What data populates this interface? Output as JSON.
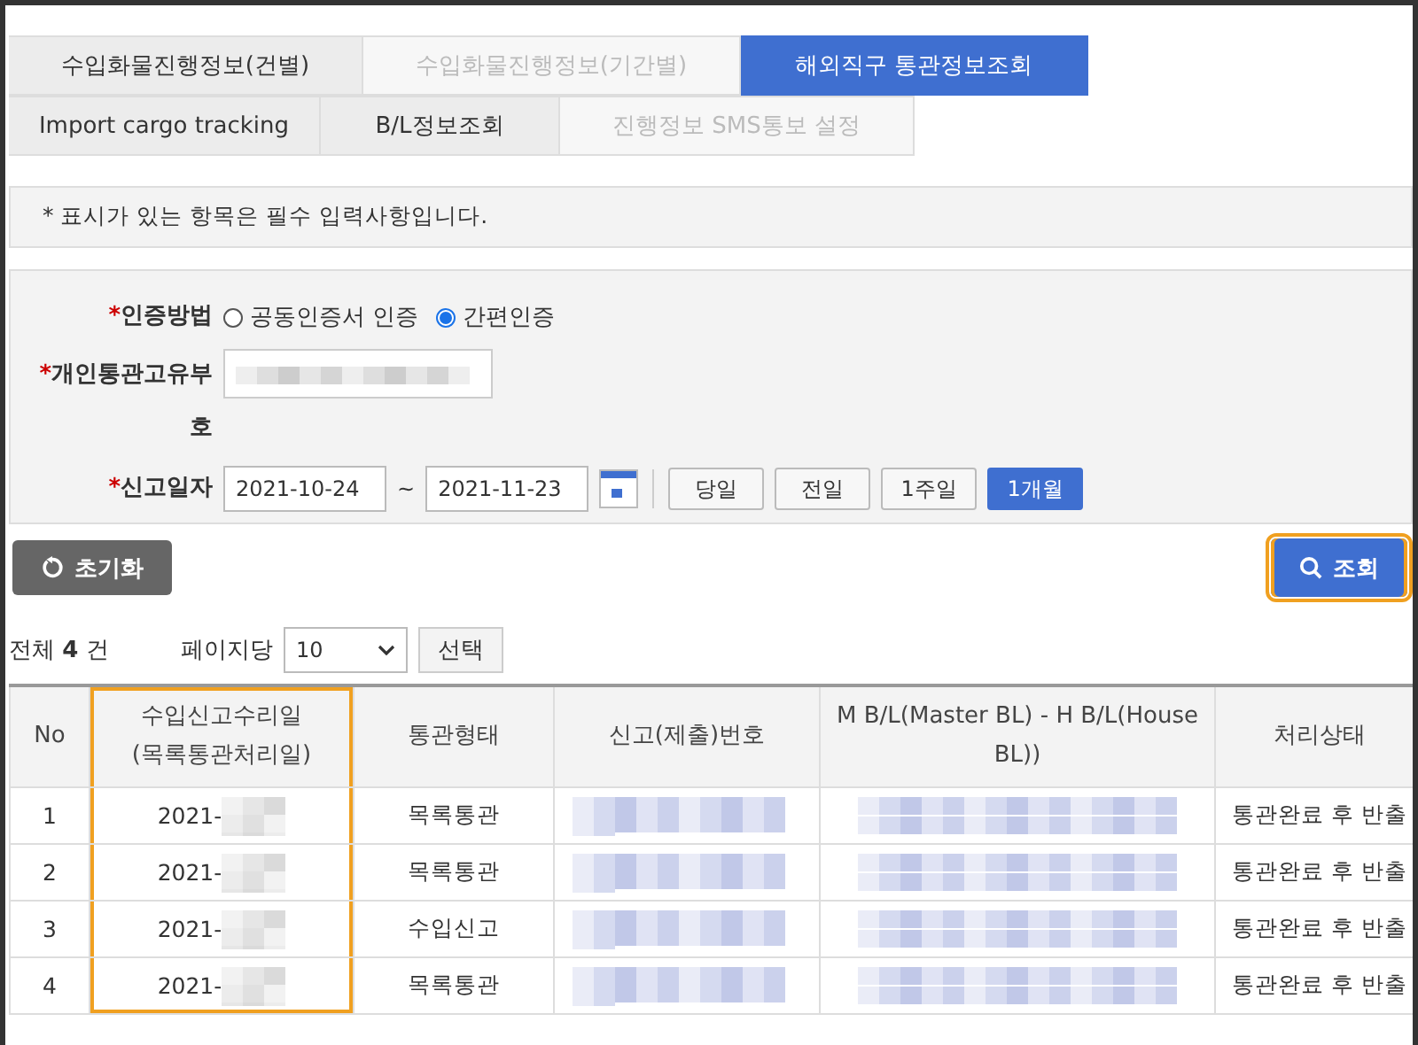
{
  "tabs_row_1": [
    {
      "label": "수입화물진행정보(건별)",
      "disabled": false,
      "selected": false
    },
    {
      "label": "수입화물진행정보(기간별)",
      "disabled": true,
      "selected": false
    },
    {
      "label": "해외직구 통관정보조회",
      "disabled": false,
      "selected": true
    }
  ],
  "tabs_row_2": [
    {
      "label": "Import cargo tracking",
      "disabled": false,
      "selected": false
    },
    {
      "label": "B/L정보조회",
      "disabled": false,
      "selected": false
    },
    {
      "label": "진행정보 SMS통보 설정",
      "disabled": true,
      "selected": false
    }
  ],
  "notice": "* 표시가 있는 항목은 필수 입력사항입니다.",
  "form": {
    "auth": {
      "label": "인증방법",
      "required_mark": "*",
      "options": [
        {
          "label": "공동인증서 인증",
          "selected": false
        },
        {
          "label": "간편인증",
          "selected": true
        }
      ]
    },
    "customs_code": {
      "label": "개인통관고유부호",
      "required_mark": "*",
      "blurred": true
    },
    "date": {
      "label": "신고일자",
      "required_mark": "*",
      "from": "2021-10-24",
      "separator": "~",
      "to": "2021-11-23",
      "ranges": [
        {
          "label": "당일",
          "selected": false
        },
        {
          "label": "전일",
          "selected": false
        },
        {
          "label": "1주일",
          "selected": false
        },
        {
          "label": "1개월",
          "selected": true
        }
      ]
    }
  },
  "reset_button": "초기화",
  "search_button": {
    "label": "조회",
    "highlighted": true
  },
  "count": {
    "prefix": "전체",
    "value": "4",
    "suffix": "건"
  },
  "per_page": {
    "label": "페이지당",
    "value": "10",
    "button": "선택"
  },
  "table": {
    "columns": [
      {
        "label": "No",
        "highlighted": false
      },
      {
        "label": "수입신고수리일\n(목록통관처리일)",
        "highlighted": true
      },
      {
        "label": "통관형태",
        "highlighted": false
      },
      {
        "label": "신고(제출)번호",
        "highlighted": false
      },
      {
        "label": "M B/L(Master BL) - H B/L(House BL))",
        "highlighted": false
      },
      {
        "label": "처리상태",
        "highlighted": false
      }
    ],
    "rows": [
      {
        "no": "1",
        "date": "2021-",
        "type": "목록통관",
        "status": "통관완료 후 반출"
      },
      {
        "no": "2",
        "date": "2021-",
        "type": "목록통관",
        "status": "통관완료 후 반출"
      },
      {
        "no": "3",
        "date": "2021-",
        "type": "수입신고",
        "status": "통관완료 후 반출"
      },
      {
        "no": "4",
        "date": "2021-",
        "type": "목록통관",
        "status": "통관완료 후 반출"
      }
    ]
  }
}
